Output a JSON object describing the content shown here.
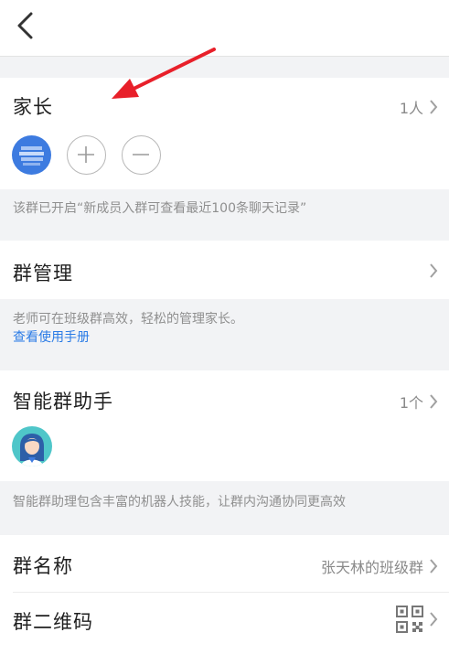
{
  "parents": {
    "title": "家长",
    "count": "1人",
    "notice": "该群已开启“新成员入群可查看最近100条聊天记录”"
  },
  "group_manage": {
    "title": "群管理",
    "note": "老师可在班级群高效，轻松的管理家长。",
    "link": "查看使用手册"
  },
  "assistant": {
    "title": "智能群助手",
    "count": "1个",
    "note": "智能群助理包含丰富的机器人技能，让群内沟通协同更高效"
  },
  "group_name": {
    "title": "群名称",
    "value": "张天林的班级群"
  },
  "qr_code": {
    "title": "群二维码"
  },
  "colors": {
    "accent": "#2a7be6",
    "annotation": "#e8202a"
  }
}
